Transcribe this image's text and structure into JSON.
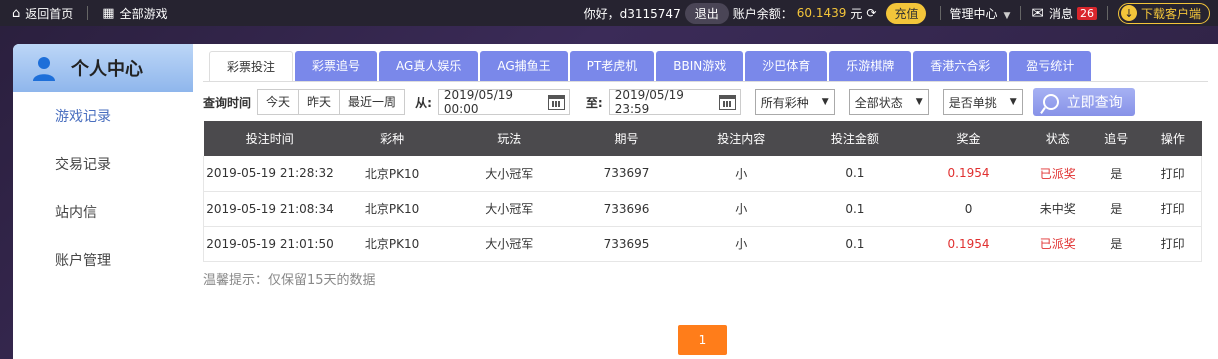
{
  "topbar": {
    "home": "返回首页",
    "all_games": "全部游戏",
    "greeting": "你好，d3115747",
    "logout": "退出",
    "balance_label": "账户余额：",
    "balance_value": "60.1439",
    "balance_unit": "元",
    "charge": "充值",
    "manage": "管理中心",
    "messages": "消息",
    "message_count": "26",
    "download": "下载客户端",
    "icons": {
      "home": "home-icon",
      "grid": "grid-icon",
      "refresh": "refresh-icon",
      "mail": "mail-icon",
      "download": "download-icon"
    }
  },
  "sidebar": {
    "title": "个人中心",
    "items": [
      {
        "label": "游戏记录",
        "active": true
      },
      {
        "label": "交易记录"
      },
      {
        "label": "站内信"
      },
      {
        "label": "账户管理"
      }
    ]
  },
  "tabs": [
    "彩票投注",
    "彩票追号",
    "AG真人娱乐",
    "AG捕鱼王",
    "PT老虎机",
    "BBIN游戏",
    "沙巴体育",
    "乐游棋牌",
    "香港六合彩",
    "盈亏统计"
  ],
  "filters": {
    "label": "查询时间",
    "quick": [
      "今天",
      "昨天",
      "最近一周"
    ],
    "from_label": "从:",
    "from_value": "2019/05/19 00:00",
    "to_label": "至:",
    "to_value": "2019/05/19 23:59",
    "lottery_select": "所有彩种",
    "status_select": "全部状态",
    "single_select": "是否单挑",
    "search_button": "立即查询"
  },
  "table": {
    "headers": [
      "投注时间",
      "彩种",
      "玩法",
      "期号",
      "投注内容",
      "投注金额",
      "奖金",
      "状态",
      "追号",
      "操作"
    ],
    "rows": [
      [
        "2019-05-19 21:28:32",
        "北京PK10",
        "大小冠军",
        "733697",
        "小",
        "0.1",
        "0.1954",
        "已派奖",
        "是",
        "打印"
      ],
      [
        "2019-05-19 21:08:34",
        "北京PK10",
        "大小冠军",
        "733696",
        "小",
        "0.1",
        "0",
        "未中奖",
        "是",
        "打印"
      ],
      [
        "2019-05-19 21:01:50",
        "北京PK10",
        "大小冠军",
        "733695",
        "小",
        "0.1",
        "0.1954",
        "已派奖",
        "是",
        "打印"
      ]
    ]
  },
  "tip": "温馨提示：仅保留15天的数据",
  "pagination": {
    "current": "1"
  },
  "colors": {
    "accent": "#7a88ea",
    "warn": "#e03030",
    "pager": "#ff7d1a",
    "gold": "#f3c53a"
  }
}
